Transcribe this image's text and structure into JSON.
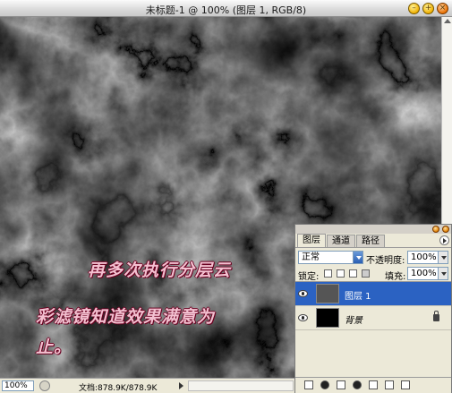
{
  "window": {
    "title": "未标题-1 @ 100% (图层 1, RGB/8)",
    "buttons": {
      "minimize": "–",
      "maximize": "+",
      "close": "×"
    }
  },
  "caption": {
    "line1": "再多次执行分层云",
    "line2": "彩滤镜知道效果满意为",
    "line3": "止。"
  },
  "status": {
    "zoom": "100%",
    "doc_info": "文档:878.9K/878.9K"
  },
  "layers_panel": {
    "tabs": [
      "图层",
      "通道",
      "路径"
    ],
    "blend_mode": "正常",
    "opacity_label": "不透明度:",
    "opacity_value": "100%",
    "lock_label": "锁定:",
    "fill_label": "填充:",
    "fill_value": "100%",
    "layers": [
      {
        "name": "图层 1",
        "selected": true
      },
      {
        "name": "背景",
        "selected": false,
        "locked": true
      }
    ],
    "bottom_icons": [
      "link-icon",
      "style-icon",
      "mask-icon",
      "adjustment-icon",
      "group-icon",
      "new-layer-icon",
      "trash-icon"
    ]
  },
  "colors": {
    "selection": "#2b62c2",
    "caption_text": "#f3c0d0",
    "caption_outline": "#6a0020"
  }
}
